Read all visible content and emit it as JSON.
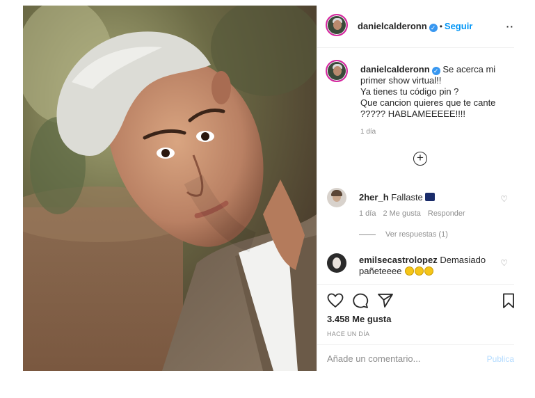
{
  "post": {
    "username": "danielcalderonn",
    "verified_icon": "verified-badge-icon",
    "separator": "•",
    "follow_label": "Seguir",
    "more_label": "··",
    "caption": "Se acerca mi primer show virtual!!\nYa tienes tu código pin ?\nQue cancion quieres que te cante\n????? HABLAMEEEEE!!!!",
    "caption_time": "1 día",
    "load_more_label": "+"
  },
  "comments": [
    {
      "username": "2her_h",
      "text": "Fallaste",
      "time": "1 día",
      "likes": "2 Me gusta",
      "reply_label": "Responder",
      "view_replies": "Ver respuestas (1)"
    },
    {
      "username": "emilsecastrolopez",
      "text": "Demasiado pañeteeee",
      "emoji_count": 3
    }
  ],
  "actions": {
    "like_icon": "heart-icon",
    "comment_icon": "comment-icon",
    "share_icon": "paper-plane-icon",
    "save_icon": "bookmark-icon",
    "likes_count": "3.458 Me gusta",
    "time_ago": "HACE UN DÍA"
  },
  "add_comment": {
    "placeholder": "Añade un comentario...",
    "publish_label": "Publica"
  },
  "colors": {
    "accent": "#0095f6",
    "publish_disabled": "#b3dbff",
    "muted": "#8e8e8e",
    "text": "#262626"
  }
}
